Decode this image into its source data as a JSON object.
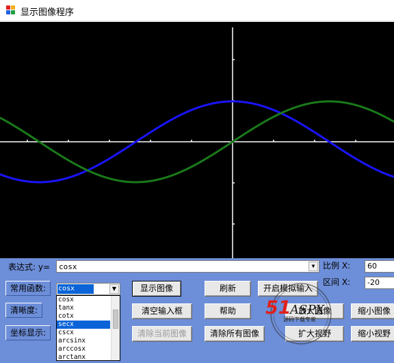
{
  "window": {
    "title": "显示图像程序"
  },
  "chart_data": {
    "type": "line",
    "series": [
      {
        "function": "cosx",
        "color": "#1a14ff"
      },
      {
        "function": "sinx",
        "color": "#1a7a1a"
      }
    ],
    "axis_color": "#ffffff",
    "background": "#000000",
    "scale": 60,
    "interval_start": -20
  },
  "controls": {
    "expression_label": "表达式:  y=",
    "expression_value": "cosx",
    "common_func_label": "常用函数:",
    "common_func_selected": "cosx",
    "func_options": [
      "cosx",
      "tanx",
      "cotx",
      "secx",
      "cscx",
      "arcsinx",
      "arccosx",
      "arctanx"
    ],
    "func_highlighted": "secx",
    "clarity_label": "清晰度:",
    "coord_label": "坐标显示:",
    "scale_label": "比例  X:",
    "scale_value": "60",
    "interval_label": "区间  X:",
    "interval_value": "-20"
  },
  "buttons": {
    "show": "显示图像",
    "refresh": "刷新",
    "simulate": "开启模拟输入",
    "clear_input": "清空输入框",
    "help": "帮助",
    "shrink_image": "缩小图像",
    "clear_current": "清除当前图像",
    "clear_all": "清除所有图像",
    "expand_view": "扩大视野",
    "shrink_view": "缩小视野",
    "enlarge_hidden": "放大图像"
  },
  "watermark": {
    "brand": "51ASPX",
    "tagline": "源码下载专家"
  }
}
